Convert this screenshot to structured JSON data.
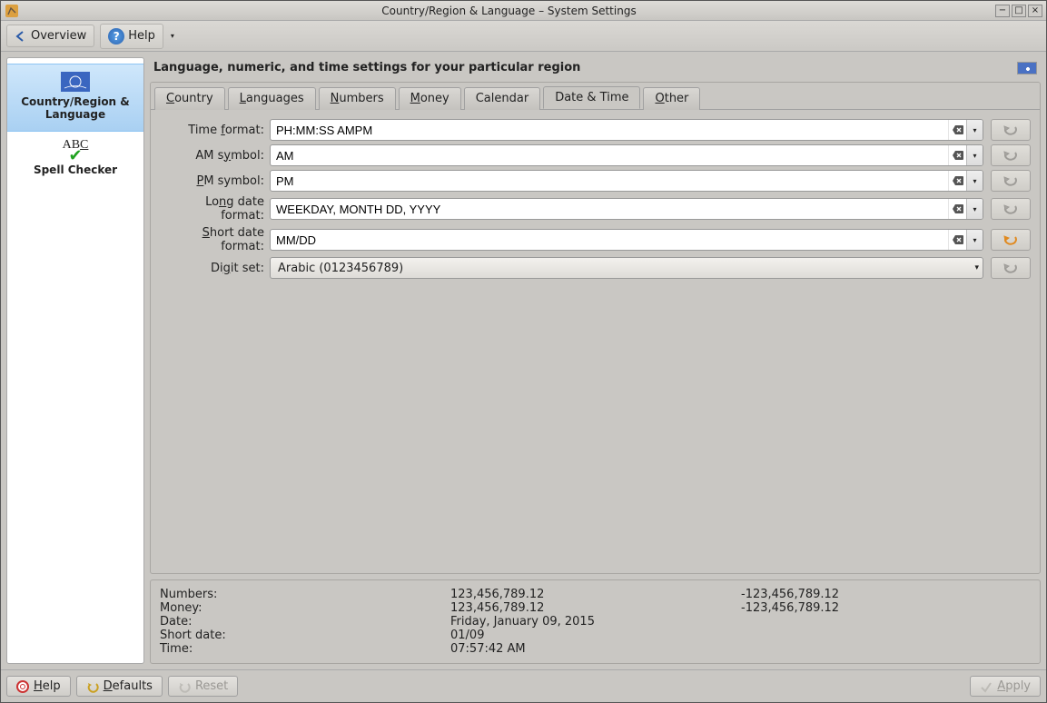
{
  "titlebar": {
    "title": "Country/Region & Language – System Settings"
  },
  "toolbar": {
    "overview": "Overview",
    "help": "Help"
  },
  "sidebar": {
    "items": [
      {
        "label": "Country/Region & Language",
        "selected": true
      },
      {
        "label": "Spell Checker",
        "selected": false
      }
    ]
  },
  "header": {
    "title": "Language, numeric, and time settings for your particular region"
  },
  "tabs": {
    "items": [
      {
        "label": "Country",
        "mnemonicIndex": 0,
        "active": false
      },
      {
        "label": "Languages",
        "mnemonicIndex": 0,
        "active": false
      },
      {
        "label": "Numbers",
        "mnemonicIndex": 0,
        "active": false
      },
      {
        "label": "Money",
        "mnemonicIndex": 0,
        "active": false
      },
      {
        "label": "Calendar",
        "mnemonicIndex": -1,
        "active": false
      },
      {
        "label": "Date & Time",
        "mnemonicIndex": -1,
        "active": true
      },
      {
        "label": "Other",
        "mnemonicIndex": 0,
        "active": false
      }
    ]
  },
  "fields": {
    "time_format": {
      "label_pre": "Time ",
      "label_mn": "f",
      "label_post": "ormat:",
      "value": "PH:MM:SS AMPM",
      "revert_highlight": false
    },
    "am_symbol": {
      "label_pre": "AM s",
      "label_mn": "y",
      "label_post": "mbol:",
      "value": "AM",
      "revert_highlight": false
    },
    "pm_symbol": {
      "label_pre": "",
      "label_mn": "P",
      "label_post": "M symbol:",
      "value": "PM",
      "revert_highlight": false
    },
    "long_date_format": {
      "label_pre": "Lo",
      "label_mn": "n",
      "label_post": "g date format:",
      "value": "WEEKDAY, MONTH DD, YYYY",
      "revert_highlight": false
    },
    "short_date_format": {
      "label_pre": "",
      "label_mn": "S",
      "label_post": "hort date format:",
      "value": "MM/DD",
      "revert_highlight": true
    },
    "digit_set": {
      "label_pre": "Di",
      "label_mn": "g",
      "label_post": "it set:",
      "value": "Arabic (0123456789)",
      "type": "select"
    }
  },
  "preview": {
    "rows": [
      {
        "label": "Numbers:",
        "v1": "123,456,789.12",
        "v2": "-123,456,789.12"
      },
      {
        "label": "Money:",
        "v1": " 123,456,789.12",
        "v2": "-123,456,789.12"
      },
      {
        "label": "Date:",
        "v1": "Friday, January 09, 2015",
        "v2": ""
      },
      {
        "label": "Short date:",
        "v1": "01/09",
        "v2": ""
      },
      {
        "label": "Time:",
        "v1": "07:57:42 AM",
        "v2": ""
      }
    ]
  },
  "bottombar": {
    "help": "Help",
    "defaults": "Defaults",
    "reset": "Reset",
    "apply": "Apply"
  }
}
